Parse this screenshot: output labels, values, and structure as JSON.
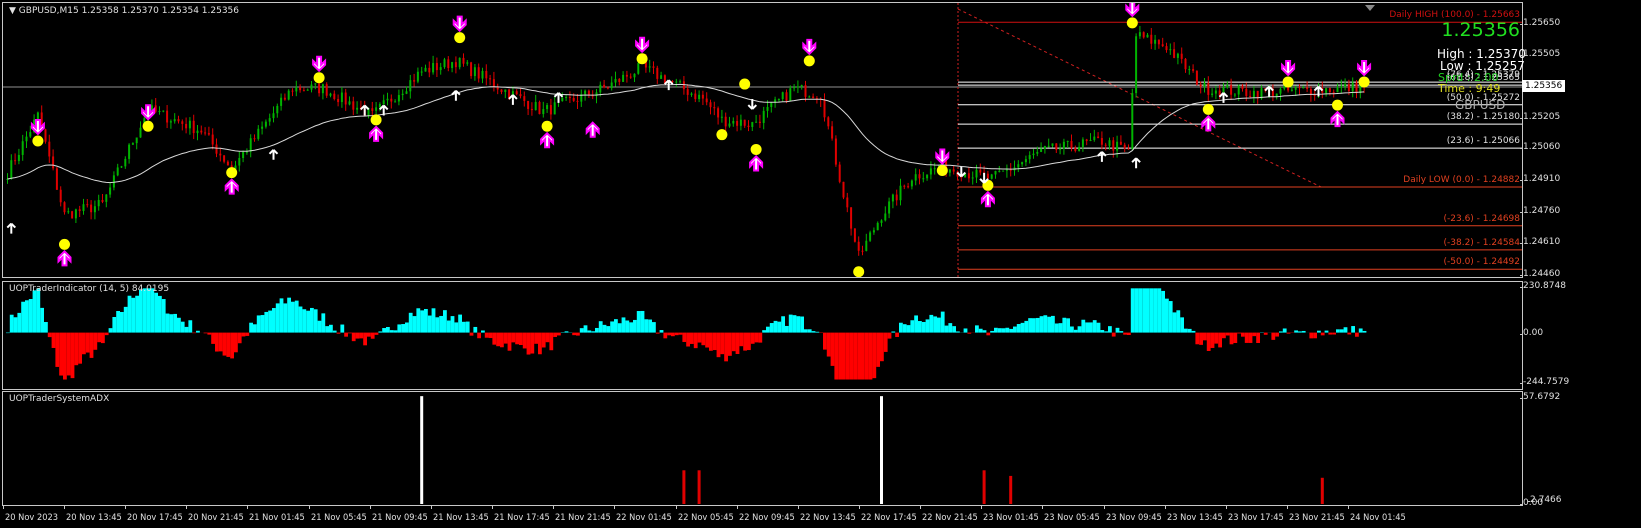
{
  "header": {
    "symbol_info": "GBPUSD,M15",
    "ohlc": "1.25358 1.25370 1.25354 1.25356"
  },
  "info_box": {
    "bid": "1.25356",
    "high": "High : 1.25370",
    "low": "Low : 1.25257",
    "spread": "Sprd :   2.00",
    "time": "Time :      9:49",
    "symbol": "GBPUSD"
  },
  "colors": {
    "bull": "#00b400",
    "bear": "#e00000",
    "ma": "#d8d8d8",
    "hist_pos": "#00ffff",
    "hist_neg": "#ff0000",
    "fib_white": "#ffffff",
    "fib_red": "#e04020",
    "high_line": "#d01010",
    "signal_dot": "#ffff00",
    "signal_arrow": "#ff00ff"
  },
  "price_axis": {
    "labels": [
      "1.25650",
      "1.25505",
      "1.25205",
      "1.25060",
      "1.24910",
      "1.24760",
      "1.24610",
      "1.24460"
    ],
    "current": "1.25356"
  },
  "indicator": {
    "title": "UOPTraderIndicator (14, 5) 84.0195",
    "max": "230.8748",
    "zero": "0.00",
    "min": "-244.7579"
  },
  "adx": {
    "title": "UOPTraderSystemADX",
    "max": "57.6792",
    "zero": "0.00",
    "last": "2.7466"
  },
  "time_axis": [
    "20 Nov 2023",
    "20 Nov 13:45",
    "20 Nov 17:45",
    "20 Nov 21:45",
    "21 Nov 01:45",
    "21 Nov 05:45",
    "21 Nov 09:45",
    "21 Nov 13:45",
    "21 Nov 17:45",
    "21 Nov 21:45",
    "22 Nov 01:45",
    "22 Nov 05:45",
    "22 Nov 09:45",
    "22 Nov 13:45",
    "22 Nov 17:45",
    "22 Nov 21:45",
    "23 Nov 01:45",
    "23 Nov 05:45",
    "23 Nov 09:45",
    "23 Nov 13:45",
    "23 Nov 17:45",
    "23 Nov 21:45",
    "24 Nov 01:45"
  ],
  "fib_levels": [
    {
      "label": "Daily HIGH (100.0) - 1.25663",
      "price": 1.25663,
      "kind": "high"
    },
    {
      "label": "(76.4) - 1.25379",
      "price": 1.25379,
      "kind": "white"
    },
    {
      "label": "(61.8) - 1.25365",
      "price": 1.25365,
      "kind": "white"
    },
    {
      "label": "(50.0) - 1.25272",
      "price": 1.25272,
      "kind": "white"
    },
    {
      "label": "(38.2) - 1.25180",
      "price": 1.2518,
      "kind": "white"
    },
    {
      "label": "(23.6) - 1.25066",
      "price": 1.25066,
      "kind": "white"
    },
    {
      "label": "Daily LOW (0.0) - 1.24882",
      "price": 1.24882,
      "kind": "red"
    },
    {
      "label": "(-23.6) - 1.24698",
      "price": 1.24698,
      "kind": "red"
    },
    {
      "label": "(-38.2) - 1.24584",
      "price": 1.24584,
      "kind": "red"
    },
    {
      "label": "(-50.0) - 1.24492",
      "price": 1.24492,
      "kind": "red"
    }
  ],
  "chart_data": {
    "type": "candlestick",
    "symbol": "GBPUSD",
    "timeframe": "M15",
    "ylim": [
      1.2446,
      1.2568
    ],
    "bars": 358,
    "close_anchors": [
      [
        0,
        1.2495
      ],
      [
        8,
        1.2522
      ],
      [
        15,
        1.2475
      ],
      [
        25,
        1.248
      ],
      [
        37,
        1.2525
      ],
      [
        51,
        1.2515
      ],
      [
        59,
        1.2497
      ],
      [
        75,
        1.2535
      ],
      [
        83,
        1.2535
      ],
      [
        96,
        1.2522
      ],
      [
        109,
        1.2543
      ],
      [
        118,
        1.2548
      ],
      [
        130,
        1.2535
      ],
      [
        141,
        1.2524
      ],
      [
        157,
        1.2535
      ],
      [
        167,
        1.2545
      ],
      [
        183,
        1.253
      ],
      [
        188,
        1.252
      ],
      [
        196,
        1.2518
      ],
      [
        207,
        1.2535
      ],
      [
        214,
        1.2532
      ],
      [
        220,
        1.2485
      ],
      [
        224,
        1.2455
      ],
      [
        230,
        1.2475
      ],
      [
        238,
        1.2493
      ],
      [
        246,
        1.2498
      ],
      [
        259,
        1.2492
      ],
      [
        272,
        1.2505
      ],
      [
        288,
        1.251
      ],
      [
        295,
        1.2505
      ],
      [
        297,
        1.256
      ],
      [
        305,
        1.2555
      ],
      [
        315,
        1.2535
      ],
      [
        328,
        1.2533
      ],
      [
        341,
        1.2534
      ],
      [
        357,
        1.25356
      ]
    ],
    "signals": [
      {
        "bar": 8,
        "price": 1.251,
        "type": "sell"
      },
      {
        "bar": 37,
        "price": 1.2517,
        "type": "sell"
      },
      {
        "bar": 82,
        "price": 1.254,
        "type": "sell"
      },
      {
        "bar": 119,
        "price": 1.2559,
        "type": "sell"
      },
      {
        "bar": 167,
        "price": 1.2549,
        "type": "sell"
      },
      {
        "bar": 211,
        "price": 1.2548,
        "type": "sell"
      },
      {
        "bar": 246,
        "price": 1.2496,
        "type": "sell"
      },
      {
        "bar": 296,
        "price": 1.2566,
        "type": "sell"
      },
      {
        "bar": 337,
        "price": 1.2538,
        "type": "sell"
      },
      {
        "bar": 357,
        "price": 1.2538,
        "type": "sell"
      },
      {
        "bar": 15,
        "price": 1.2461,
        "type": "buy"
      },
      {
        "bar": 59,
        "price": 1.2495,
        "type": "buy"
      },
      {
        "bar": 97,
        "price": 1.252,
        "type": "buy"
      },
      {
        "bar": 142,
        "price": 1.2517,
        "type": "buy"
      },
      {
        "bar": 197,
        "price": 1.2506,
        "type": "buy"
      },
      {
        "bar": 258,
        "price": 1.2489,
        "type": "buy"
      },
      {
        "bar": 316,
        "price": 1.2525,
        "type": "buy"
      },
      {
        "bar": 350,
        "price": 1.2527,
        "type": "buy"
      },
      {
        "bar": 188,
        "price": 1.2513,
        "type": "dot"
      },
      {
        "bar": 194,
        "price": 1.2537,
        "type": "dot"
      },
      {
        "bar": 224,
        "price": 1.2448,
        "type": "dot"
      },
      {
        "bar": 154,
        "price": 1.2522,
        "type": "buy_arrow"
      }
    ],
    "small_arrows": [
      {
        "bar": 1,
        "price": 1.2468,
        "dir": "up"
      },
      {
        "bar": 70,
        "price": 1.2503,
        "dir": "up"
      },
      {
        "bar": 94,
        "price": 1.2524,
        "dir": "up"
      },
      {
        "bar": 99,
        "price": 1.2524,
        "dir": "up"
      },
      {
        "bar": 118,
        "price": 1.2531,
        "dir": "up"
      },
      {
        "bar": 133,
        "price": 1.2529,
        "dir": "up"
      },
      {
        "bar": 145,
        "price": 1.253,
        "dir": "up"
      },
      {
        "bar": 174,
        "price": 1.2536,
        "dir": "up"
      },
      {
        "bar": 288,
        "price": 1.2502,
        "dir": "up"
      },
      {
        "bar": 297,
        "price": 1.2499,
        "dir": "up"
      },
      {
        "bar": 320,
        "price": 1.253,
        "dir": "up"
      },
      {
        "bar": 332,
        "price": 1.2533,
        "dir": "up"
      },
      {
        "bar": 345,
        "price": 1.2533,
        "dir": "up"
      },
      {
        "bar": 196,
        "price": 1.2528,
        "dir": "down"
      },
      {
        "bar": 251,
        "price": 1.2496,
        "dir": "down"
      },
      {
        "bar": 257,
        "price": 1.2493,
        "dir": "down"
      }
    ],
    "indicator_range": [
      -244.7579,
      230.8748
    ],
    "adx_range": [
      0,
      57.6792
    ],
    "adx_spikes": [
      {
        "bar": 109,
        "value": 57.6,
        "color": "white"
      },
      {
        "bar": 230,
        "value": 57.6,
        "color": "white"
      },
      {
        "bar": 178,
        "value": 18,
        "color": "red"
      },
      {
        "bar": 182,
        "value": 18,
        "color": "red"
      },
      {
        "bar": 257,
        "value": 18,
        "color": "red"
      },
      {
        "bar": 264,
        "value": 15,
        "color": "red"
      },
      {
        "bar": 346,
        "value": 14,
        "color": "red"
      }
    ]
  }
}
